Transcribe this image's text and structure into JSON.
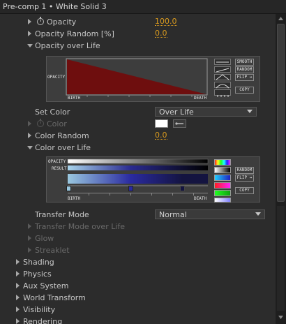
{
  "header": {
    "title": "Pre-comp 1 • White Solid 3"
  },
  "rows": {
    "opacity": {
      "label": "Opacity",
      "value": "100.0"
    },
    "opacity_random": {
      "label": "Opacity Random [%]",
      "value": "0.0"
    },
    "opacity_over_life": {
      "label": "Opacity over Life"
    },
    "set_color": {
      "label": "Set Color",
      "value": "Over Life"
    },
    "color": {
      "label": "Color",
      "swatch": "#ffffff"
    },
    "color_random": {
      "label": "Color Random",
      "value": "0.0"
    },
    "color_over_life": {
      "label": "Color over Life"
    },
    "transfer_mode": {
      "label": "Transfer Mode",
      "value": "Normal"
    },
    "transfer_mode_over_life": {
      "label": "Transfer Mode over Life"
    },
    "glow": {
      "label": "Glow"
    },
    "streaklet": {
      "label": "Streaklet"
    }
  },
  "groups": [
    "Shading",
    "Physics",
    "Aux System",
    "World Transform",
    "Visibility",
    "Rendering"
  ],
  "opacity_graph": {
    "y_label": "OPACITY",
    "birth": "BIRTH",
    "death": "DEATH",
    "buttons": {
      "smooth": "SMOOTH",
      "random": "RANDOM",
      "flip": "FLIP ↔",
      "copy": "COPY"
    },
    "fill_color": "#6e0e0e",
    "start_level": 1.0,
    "end_level": 0.0
  },
  "color_graph": {
    "opacity_label": "OPACITY",
    "result_label": "RESULT",
    "birth": "BIRTH",
    "death": "DEATH",
    "buttons": {
      "random": "RANDOM",
      "flip": "FLIP ↔",
      "copy": "COPY"
    },
    "stop_colors": [
      "#9ac8e0",
      "#2a2aa0",
      "#141440"
    ]
  },
  "colors": {
    "accent_value": "#d99a1e",
    "panel": "#2c2c2c"
  },
  "icons": {
    "stopwatch": "stopwatch-icon",
    "eyedropper": "eyedropper-icon",
    "expand": "triangle-icon"
  }
}
